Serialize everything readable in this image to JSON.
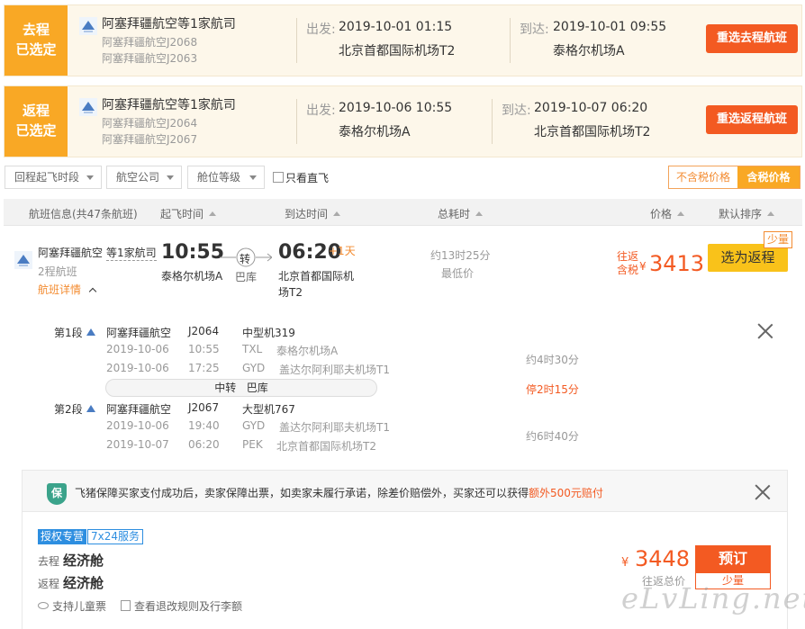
{
  "outbound": {
    "tag_line1": "去程",
    "tag_line2": "已选定",
    "airline": "阿塞拜疆航空等1家航司",
    "flight1": "阿塞拜疆航空J2068",
    "flight2": "阿塞拜疆航空J2063",
    "dep_label": "出发:",
    "dep_time": "2019-10-01 01:15",
    "dep_airport": "北京首都国际机场T2",
    "arr_label": "到达:",
    "arr_time": "2019-10-01 09:55",
    "arr_airport": "泰格尔机场A",
    "button": "重选去程航班"
  },
  "return_sel": {
    "tag_line1": "返程",
    "tag_line2": "已选定",
    "airline": "阿塞拜疆航空等1家航司",
    "flight1": "阿塞拜疆航空J2064",
    "flight2": "阿塞拜疆航空J2067",
    "dep_label": "出发:",
    "dep_time": "2019-10-06 10:55",
    "dep_airport": "泰格尔机场A",
    "arr_label": "到达:",
    "arr_time": "2019-10-07 06:20",
    "arr_airport": "北京首都国际机场T2",
    "button": "重选返程航班"
  },
  "filters": {
    "return_time": "回程起飞时段",
    "airline": "航空公司",
    "cabin": "舱位等级",
    "direct_only": "只看直飞",
    "price_excl": "不含税价格",
    "price_incl": "含税价格"
  },
  "table_header": {
    "info": "航班信息(共47条航班)",
    "dep": "起飞时间",
    "arr": "到达时间",
    "duration": "总耗时",
    "price": "价格",
    "sort": "默认排序"
  },
  "flight": {
    "airline": "阿塞拜疆航空",
    "carriers": "等1家航司",
    "segments": "2程航班",
    "details_link": "航班详情",
    "dep_time": "10:55",
    "dep_airport": "泰格尔机场A",
    "transfer_word": "转",
    "transfer_city": "巴库",
    "arr_time": "06:20",
    "plus_day": "+1天",
    "arr_airport_line1": "北京首都国际机",
    "arr_airport_line2": "场T2",
    "duration": "约13时25分",
    "lowest": "最低价",
    "price_label1": "往返",
    "price_label2": "含税",
    "currency": "¥",
    "price": "3413",
    "select_button": "选为返程",
    "few_badge": "少量"
  },
  "segments": [
    {
      "label": "第1段",
      "airline": "阿塞拜疆航空",
      "flight_no": "J2064",
      "aircraft": "中型机319",
      "dep_date": "2019-10-06",
      "dep_time": "10:55",
      "dep_code": "TXL",
      "dep_airport": "泰格尔机场A",
      "arr_date": "2019-10-06",
      "arr_time": "17:25",
      "arr_code": "GYD",
      "arr_airport": "盖达尔阿利耶夫机场T1",
      "duration": "约4时30分"
    },
    {
      "label": "第2段",
      "airline": "阿塞拜疆航空",
      "flight_no": "J2067",
      "aircraft": "大型机767",
      "dep_date": "2019-10-06",
      "dep_time": "19:40",
      "dep_code": "GYD",
      "dep_airport": "盖达尔阿利耶夫机场T1",
      "arr_date": "2019-10-07",
      "arr_time": "06:20",
      "arr_code": "PEK",
      "arr_airport": "北京首都国际机场T2",
      "duration": "约6时40分"
    }
  ],
  "transfer": {
    "label": "中转",
    "city": "巴库",
    "stop": "停2时15分"
  },
  "offer": {
    "shield_char": "保",
    "notice_main": "飞猪保障买家支付成功后，卖家保障出票，如卖家未履行承诺，除差价赔偿外，买家还可以获得",
    "notice_highlight": "额外500元赔付",
    "badge_auth": "授权专营",
    "badge_service": "7x24服务",
    "out_label": "去程",
    "out_cabin": "经济舱",
    "ret_label": "返程",
    "ret_cabin": "经济舱",
    "currency": "¥",
    "price": "3448",
    "price_note": "往返总价",
    "book": "预订",
    "few": "少量",
    "child_ticket": "支持儿童票",
    "rules": "查看退改规则及行李额"
  },
  "watermark": "eLvLing.net"
}
